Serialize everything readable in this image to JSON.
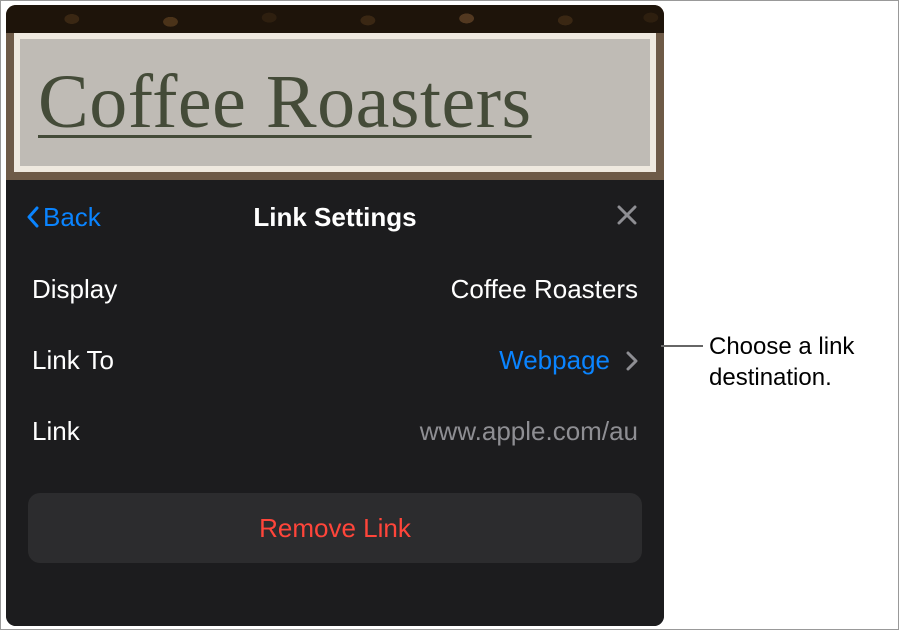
{
  "document": {
    "linked_text": "Coffee Roasters"
  },
  "panel": {
    "back_label": "Back",
    "title": "Link Settings"
  },
  "rows": {
    "display": {
      "label": "Display",
      "value": "Coffee Roasters"
    },
    "link_to": {
      "label": "Link To",
      "value": "Webpage"
    },
    "link": {
      "label": "Link",
      "placeholder": "www.apple.com/au"
    }
  },
  "actions": {
    "remove_label": "Remove Link"
  },
  "callout": {
    "text": "Choose a link destination."
  },
  "colors": {
    "accent": "#0a84ff",
    "destructive": "#ff453a",
    "panel_bg": "#1c1c1e"
  }
}
